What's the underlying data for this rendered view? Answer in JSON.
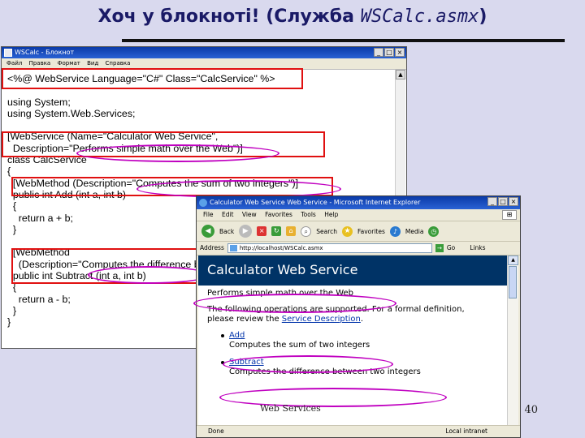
{
  "slide": {
    "title_text": "Хоч у блокноті! (Служба ",
    "title_mono": "WSCalc.asmx",
    "title_end": ")",
    "page_number": "40",
    "overlay_caption": "Web Services"
  },
  "notepad": {
    "window_title": "WSCalc - Блокнот",
    "menu": [
      "Файл",
      "Правка",
      "Формат",
      "Вид",
      "Справка"
    ],
    "code_lines": [
      "<%@ WebService Language=\"C#\" Class=\"CalcService\" %>",
      "",
      "using System;",
      "using System.Web.Services;",
      "",
      "[WebService (Name=\"Calculator Web Service\",",
      "  Description=\"Performs simple math over the Web\")]",
      "class CalcService",
      "{",
      "  [WebMethod (Description=\"Computes the sum of two integers\")]",
      "  public int Add (int a, int b)",
      "  {",
      "    return a + b;",
      "  }",
      "",
      "  [WebMethod",
      "    (Description=\"Computes the difference between two integers\")]",
      "  public int Subtract (int a, int b)",
      "  {",
      "    return a - b;",
      "  }",
      "}"
    ]
  },
  "browser": {
    "window_title": "Calculator Web Service Web Service - Microsoft Internet Explorer",
    "menu": [
      "File",
      "Edit",
      "View",
      "Favorites",
      "Tools",
      "Help"
    ],
    "toolbar": {
      "back": "Back",
      "search": "Search",
      "favorites": "Favorites",
      "media": "Media"
    },
    "address_label": "Address",
    "address_value": "http://localhost/WSCalc.asmx",
    "go_label": "Go",
    "links_label": "Links",
    "page": {
      "heading": "Calculator Web Service",
      "description": "Performs simple math over the Web",
      "intro_1": "The following operations are supported. For a formal definition,",
      "intro_2": "please review the ",
      "service_description_link": "Service Description",
      "intro_end": ".",
      "operations": [
        {
          "name": "Add",
          "description": "Computes the sum of two integers"
        },
        {
          "name": "Subtract",
          "description": "Computes the difference between two integers"
        }
      ]
    },
    "status_left": "Done",
    "status_right": "Local intranet"
  },
  "colors": {
    "highlight_box": "#e01010",
    "highlight_ellipse": "#c000c0",
    "banner": "#003366",
    "title_text": "#1a1a66"
  }
}
